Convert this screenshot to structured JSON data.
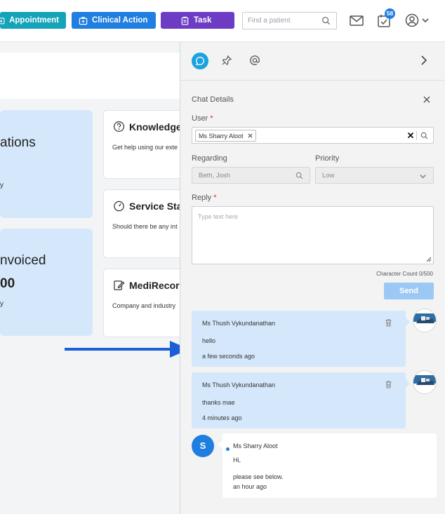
{
  "topbar": {
    "appointment_label": "Appointment",
    "clinical_action_label": "Clinical Action",
    "task_label": "Task",
    "search_placeholder": "Find a patient",
    "notification_count": "58",
    "colors": {
      "appointment": "#14a3b8",
      "clinical_action": "#1f7ee0",
      "task": "#6e3cc4"
    }
  },
  "dashboard": {
    "card1_text": "ations",
    "card1_sub": "y",
    "card2_text": "nvoiced",
    "card2_value": "00",
    "card2_sub": "y",
    "knowledge_title": "Knowledge",
    "knowledge_desc": "Get help using our exte",
    "service_title": "Service Sta",
    "service_desc": "Should there be any int",
    "medirecords_title": "MediRecord",
    "medirecords_desc": "Company and industry"
  },
  "panel": {
    "title": "Chat Details",
    "user_label": "User",
    "required_mark": "*",
    "user_chip": "Ms Sharry Aloot",
    "regarding_label": "Regarding",
    "regarding_value": "Beth, Josh",
    "priority_label": "Priority",
    "priority_value": "Low",
    "reply_label": "Reply",
    "reply_placeholder": "Type text here",
    "char_count": "Character Count 0/500",
    "send_label": "Send"
  },
  "messages": [
    {
      "author": "Ms Thush Vykundanathan",
      "text": "hello",
      "time": "a few seconds ago"
    },
    {
      "author": "Ms Thush Vykundanathan",
      "text": "thanks mae",
      "time": "4 minutes ago"
    }
  ],
  "incoming": {
    "avatar_initial": "S",
    "author": "Ms Sharry Aloot",
    "line1": "Hi,",
    "line2": "please see below.",
    "time": "an hour ago"
  }
}
